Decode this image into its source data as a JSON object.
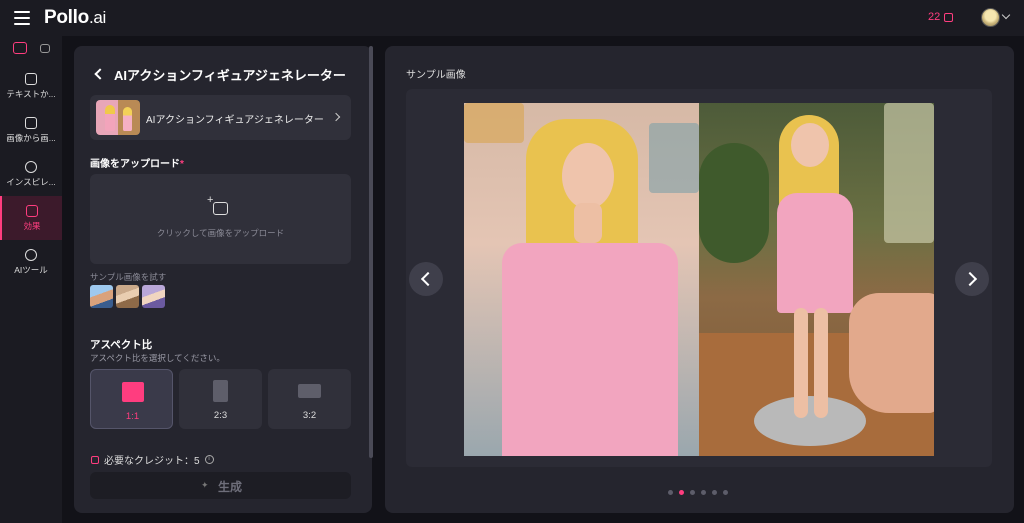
{
  "topbar": {
    "logo_main": "Pollo",
    "logo_suffix": ".ai",
    "credits": "22",
    "credit_icon": "coin-icon",
    "accent_color": "#ff3d7f"
  },
  "leftnav": {
    "modes": [
      {
        "icon": "image-mode-icon",
        "active": true
      },
      {
        "icon": "video-mode-icon",
        "active": false
      }
    ],
    "items": [
      {
        "label": "テキストか...",
        "icon": "text-to-image-icon"
      },
      {
        "label": "画像から画...",
        "icon": "image-to-image-icon"
      },
      {
        "label": "インスピレ...",
        "icon": "compass-icon"
      },
      {
        "label": "効果",
        "icon": "effects-icon",
        "active": true
      },
      {
        "label": "AIツール",
        "icon": "ai-tools-icon"
      }
    ]
  },
  "panel": {
    "title": "AIアクションフィギュアジェネレーター",
    "tool_select_label": "AIアクションフィギュアジェネレーター",
    "upload": {
      "label": "画像をアップロード",
      "required_mark": "*",
      "hint": "クリックして画像をアップロード"
    },
    "samples_label": "サンプル画像を試す",
    "aspect": {
      "title": "アスペクト比",
      "subtitle": "アスペクト比を選択してください。",
      "options": [
        {
          "label": "1:1",
          "selected": true
        },
        {
          "label": "2:3",
          "selected": false
        },
        {
          "label": "3:2",
          "selected": false
        }
      ]
    },
    "credit_required": "必要なクレジット：5",
    "generate_label": "生成"
  },
  "preview": {
    "title": "サンプル画像",
    "slides_total": 6,
    "active_slide_index": 1
  }
}
